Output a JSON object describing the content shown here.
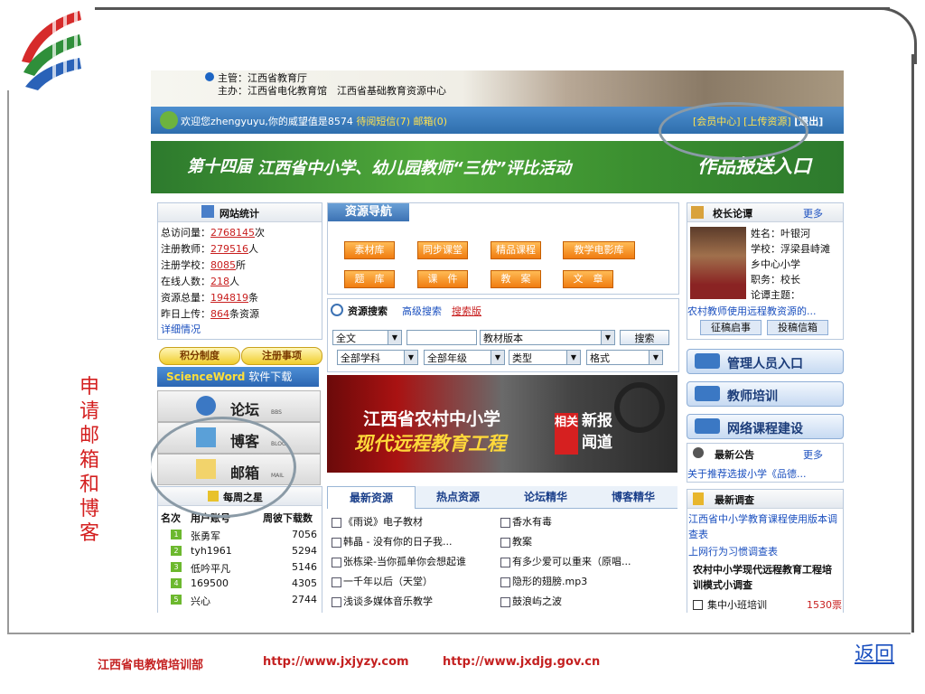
{
  "slide": {
    "side_caption": "申请邮箱和博客",
    "back_label": "返回",
    "footer": {
      "org": "江西省电教馆培训部",
      "url1": "http://www.jxjyzy.com",
      "url2": "http://www.jxdjg.gov.cn"
    }
  },
  "site": {
    "header": {
      "sponsor": "主管：江西省教育厅",
      "host": "主办：江西省电化教育馆　江西省基础教育资源中心"
    },
    "welcome": {
      "text": "欢迎您zhengyuyu,你的威望值是8574",
      "messages": "待阅短信(7)",
      "mailbox": "邮箱(0)",
      "member_center": "[会员中心]",
      "upload": "[上传资源]",
      "logout": "[退出]"
    },
    "banner": {
      "edition": "第十四届",
      "title": "江西省中小学、幼儿园教师“三优”评比活动",
      "entry": "作品报送入口"
    },
    "stats": {
      "title": "网站统计",
      "rows": [
        {
          "label": "总访问量：",
          "value": "2768145",
          "unit": "次"
        },
        {
          "label": "注册教师：",
          "value": "279516",
          "unit": "人"
        },
        {
          "label": "注册学校：",
          "value": "8085",
          "unit": "所"
        },
        {
          "label": "在线人数：",
          "value": "218",
          "unit": "人"
        },
        {
          "label": "资源总量：",
          "value": "194819",
          "unit": "条"
        },
        {
          "label": "昨日上传：",
          "value": "864",
          "unit": "条资源"
        }
      ],
      "details": "详细情况"
    },
    "left": {
      "points": "积分制度",
      "register": "注册事项",
      "scienceword": "ScienceWord",
      "software": "软件下载",
      "forum": "论坛",
      "forum_sub": "BBS",
      "blog": "博客",
      "blog_sub": "BLOG",
      "mail": "邮箱",
      "mail_sub": "MAIL"
    },
    "weekly": {
      "title": "每周之星",
      "headers": [
        "名次",
        "用户账号",
        "周彼下载数"
      ],
      "rows": [
        {
          "rank": "1",
          "user": "张勇军",
          "count": "7056"
        },
        {
          "rank": "2",
          "user": "tyh1961",
          "count": "5294"
        },
        {
          "rank": "3",
          "user": "低吟平凡",
          "count": "5146"
        },
        {
          "rank": "4",
          "user": "169500",
          "count": "4305"
        },
        {
          "rank": "5",
          "user": "兴心",
          "count": "2744"
        }
      ]
    },
    "nav": {
      "title": "资源导航",
      "row1": [
        "素材库",
        "同步课堂",
        "精品课程",
        "教学电影库"
      ],
      "row2": [
        "题　库",
        "课　件",
        "教　案",
        "文　章"
      ]
    },
    "search": {
      "title": "资源搜索",
      "advanced": "高级搜索",
      "search_bar": "搜索版",
      "scope": "全文",
      "version": "教材版本",
      "button": "搜索",
      "subject": "全部学科",
      "grade": "全部年级",
      "type": "类型",
      "format": "格式"
    },
    "promo": {
      "line1": "江西省农村中小学",
      "line2": "现代远程教育工程",
      "tag1": "相关",
      "tag2": "新报",
      "tag3": "闻道"
    },
    "tabs": [
      "最新资源",
      "热点资源",
      "论坛精华",
      "博客精华"
    ],
    "resources_left": [
      "《雨说》电子教材",
      "韩晶 - 没有你的日子我...",
      "张栋梁-当你孤单你会想起谁",
      "一千年以后（天堂）",
      "浅谈多媒体音乐教学"
    ],
    "resources_right": [
      "香水有毒",
      "教案",
      "有多少爱可以重来（原唱...",
      "隐形的翅膀.mp3",
      "鼓浪屿之波"
    ],
    "principal": {
      "title": "校长论谭",
      "more": "更多",
      "name": "姓名：叶银河",
      "school": "学校：浮梁县峙滩",
      "school2": "乡中心小学",
      "position": "职务：校长",
      "topic": "论谭主题：",
      "link": "农村教师使用远程教资源的...",
      "call": "征稿启事",
      "mailbox": "投稿信箱"
    },
    "right_buttons": [
      "管理人员入口",
      "教师培训",
      "网络课程建设"
    ],
    "notice": {
      "title": "最新公告",
      "more": "更多",
      "item": "关于推荐选拔小学《品德..."
    },
    "survey": {
      "title": "最新调查",
      "items": [
        "江西省中小学教育课程使用版本调查表",
        "上网行为习惯调查表"
      ],
      "highlight": "农村中小学现代远程教育工程培训模式小调查",
      "option": "集中小班培训",
      "votes": "1530票"
    }
  }
}
